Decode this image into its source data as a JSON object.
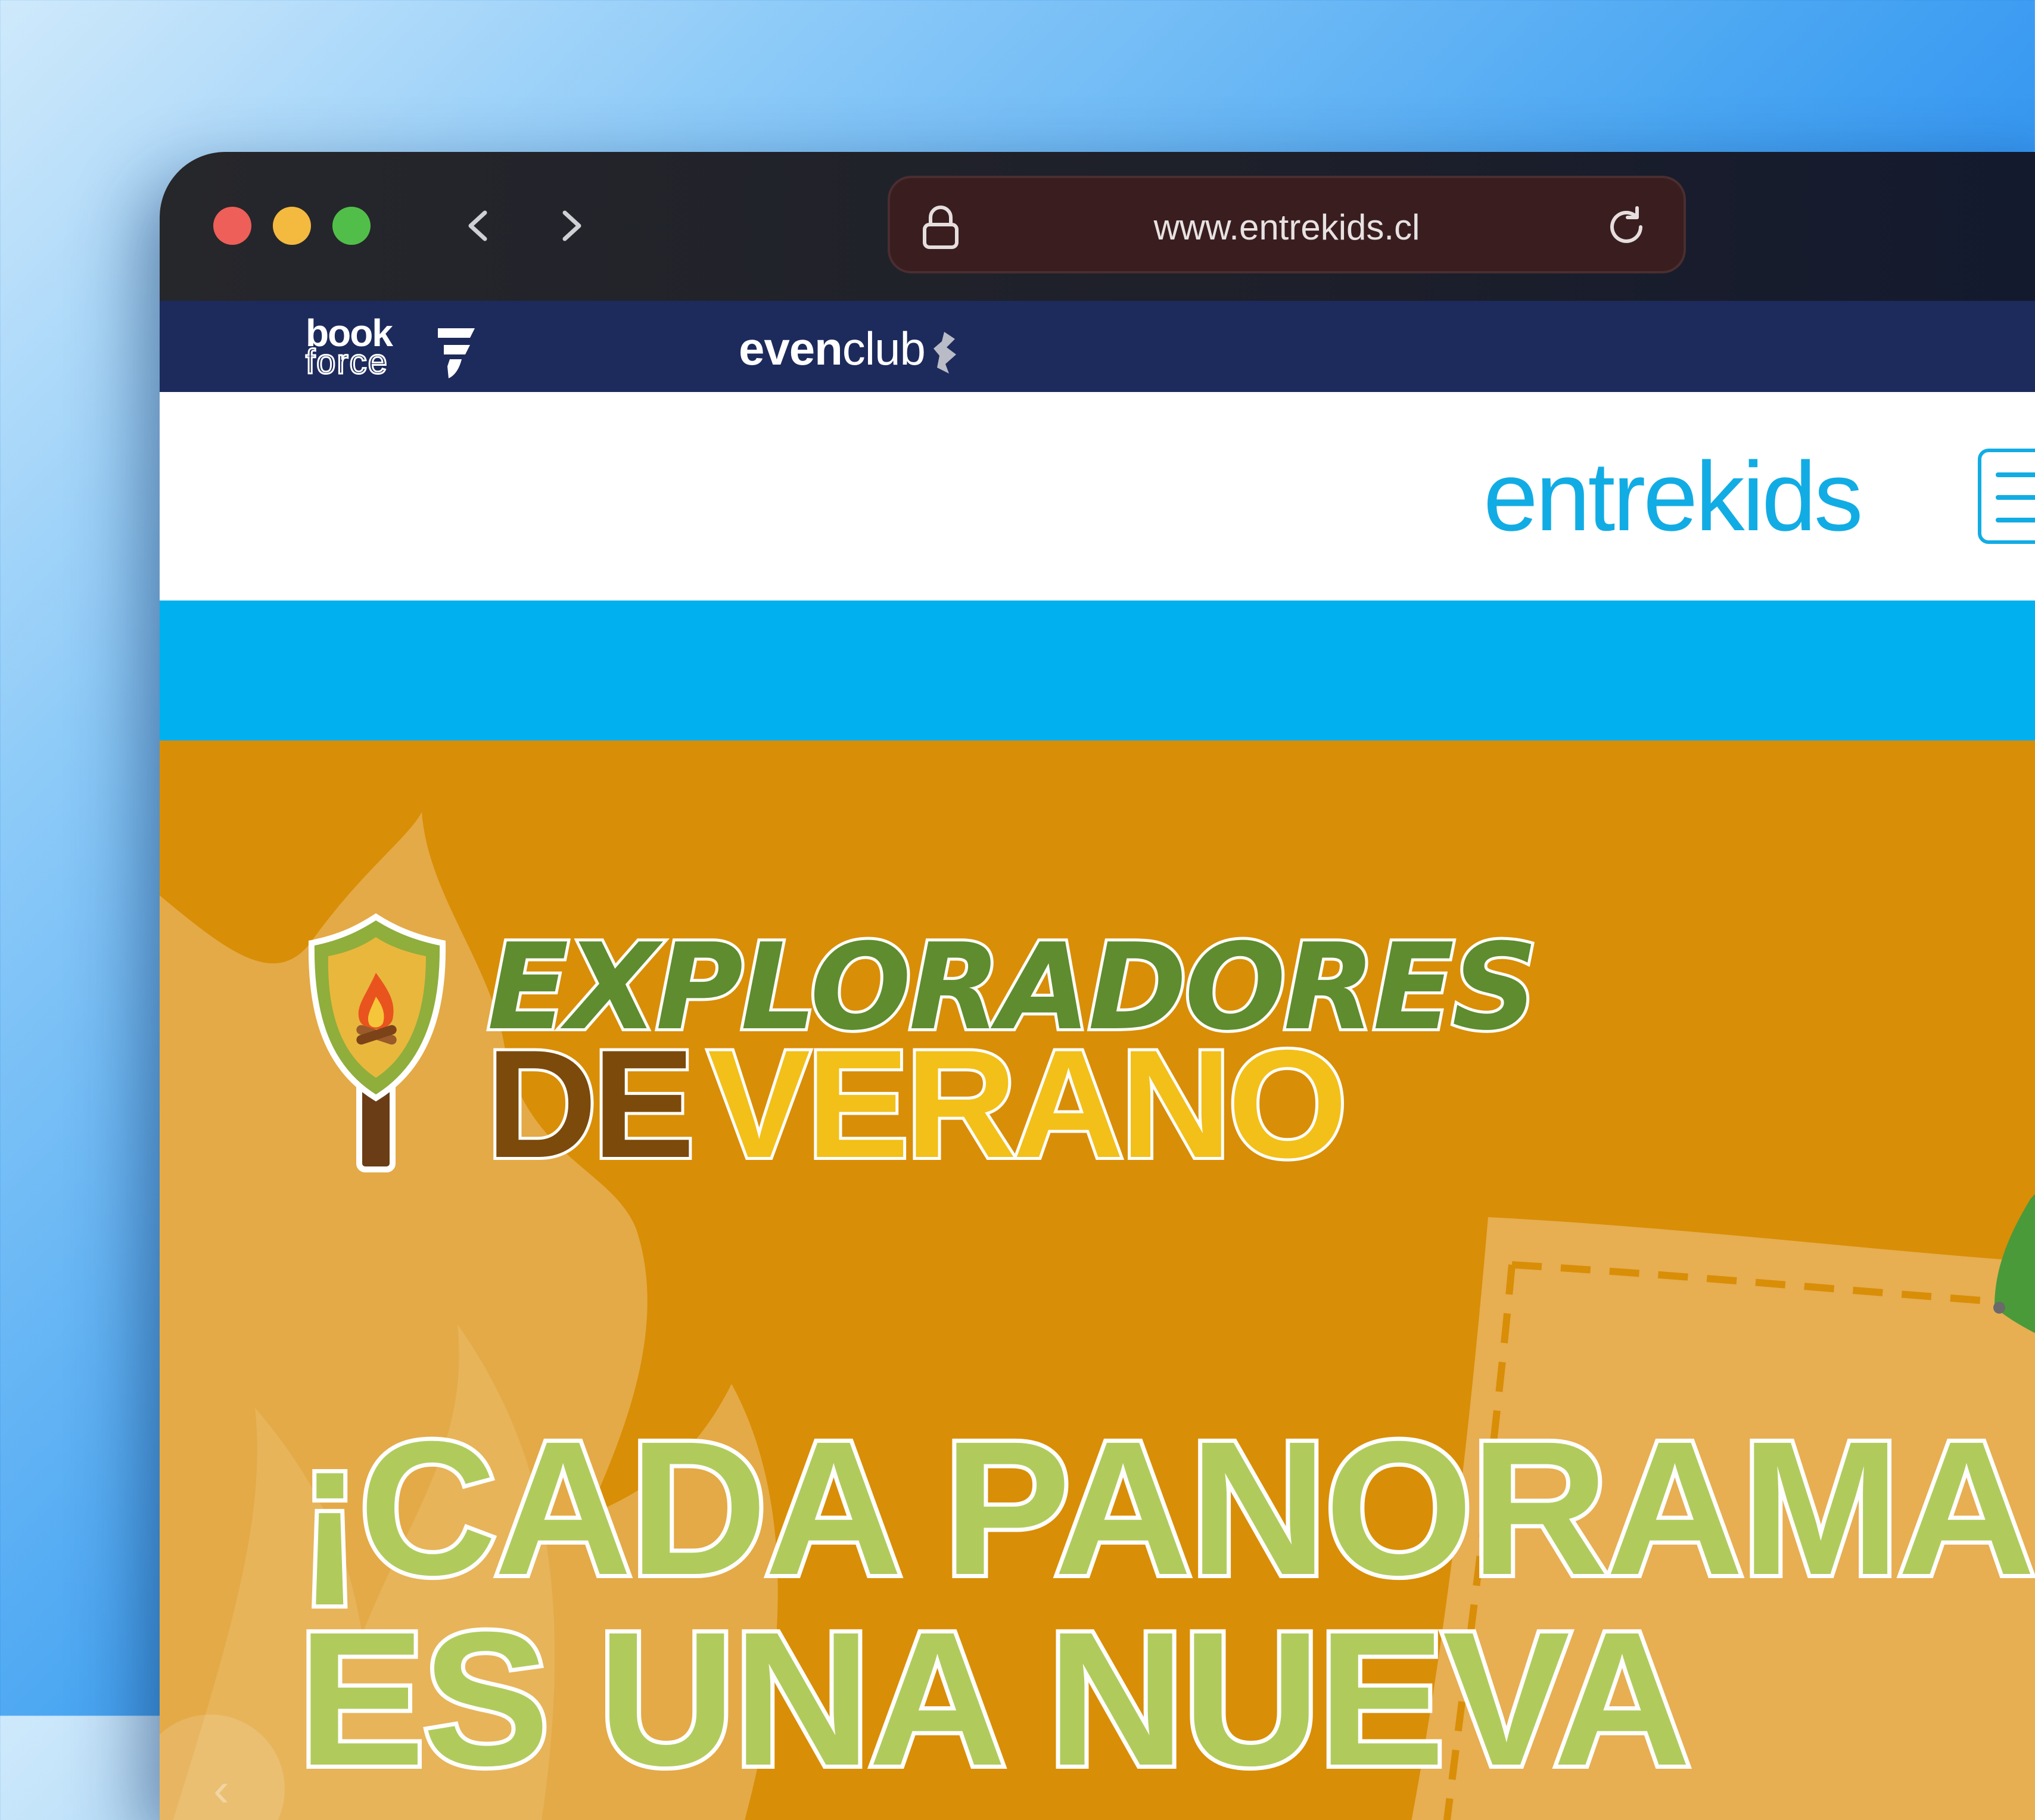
{
  "browser": {
    "url": "www.entrekids.cl",
    "back_icon": "chevron-left-icon",
    "forward_icon": "chevron-right-icon",
    "lock_icon": "lock-icon",
    "reload_icon": "reload-icon"
  },
  "topbar": {
    "brands": [
      {
        "name": "bookforce",
        "line1": "book",
        "line2": "force"
      },
      {
        "name": "evenclub",
        "part1": "even",
        "part2": "club"
      }
    ],
    "background": "#1d2a5c"
  },
  "header": {
    "logo": "entrekids",
    "menu_icon": "hamburger-menu-icon",
    "accent": "#12ace4"
  },
  "hero": {
    "campaign_line1": "EXPLORADORES",
    "campaign_line2a": "DE",
    "campaign_line2b": "VERANO",
    "headline": "¡CADA PANORAMA\nES UNA NUEVA",
    "carousel_prev_label": "‹",
    "background": "#d98e07",
    "headline_color": "#b0cb5c"
  },
  "colors": {
    "traffic_red": "#ed5f58",
    "traffic_yellow": "#f4b93f",
    "traffic_green": "#52be4a",
    "blue_band": "#00b0ef"
  }
}
